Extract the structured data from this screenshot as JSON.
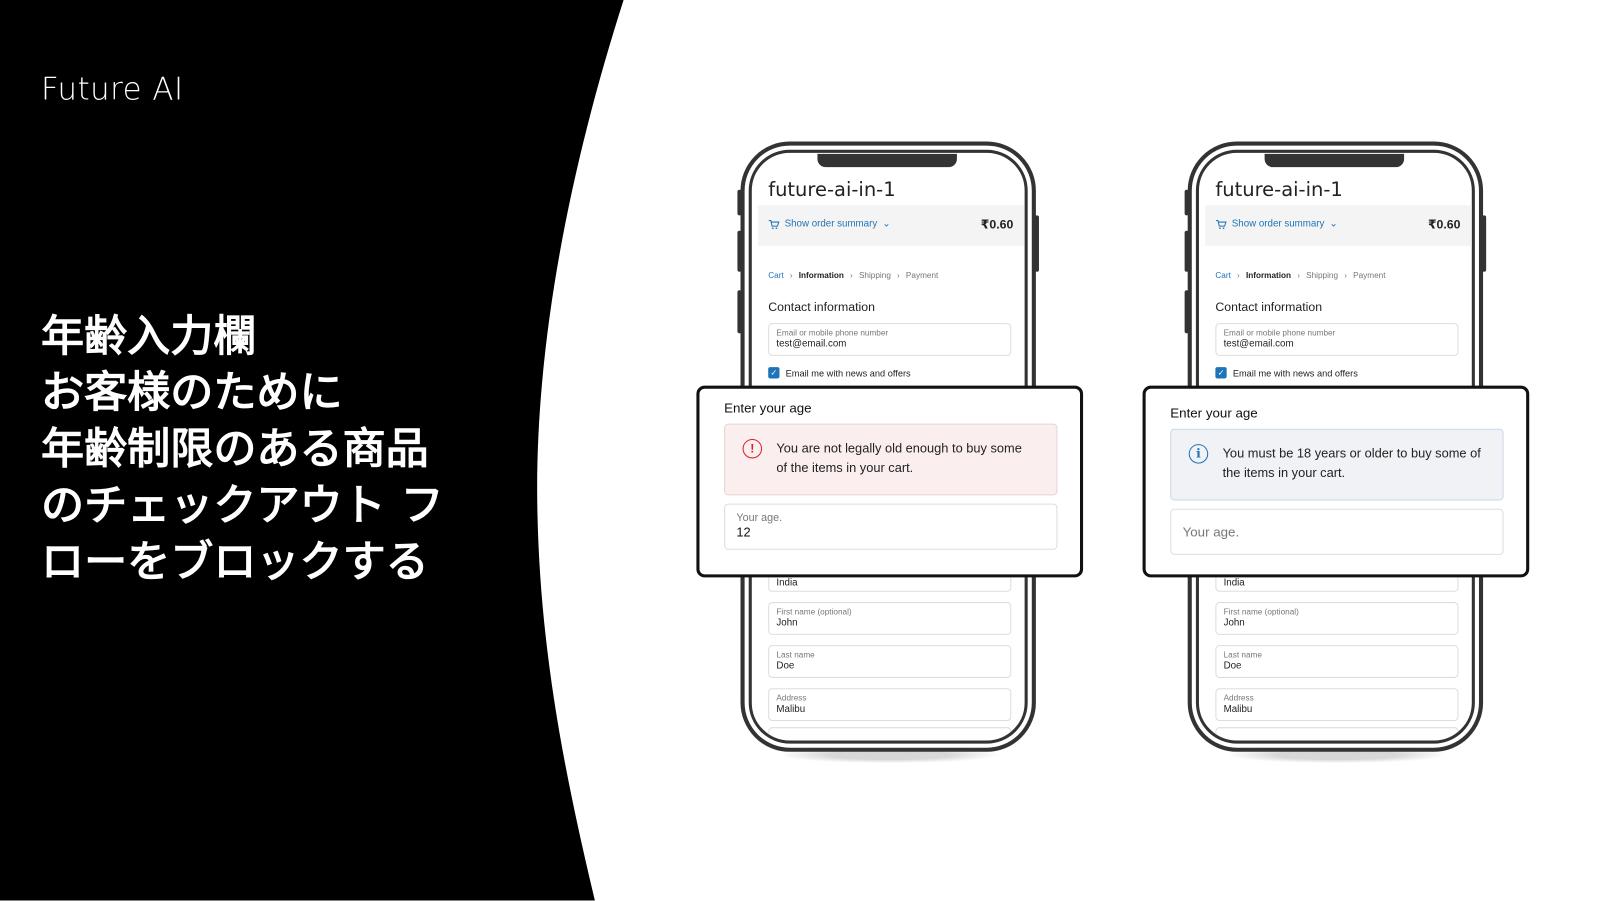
{
  "brand": "Future AI",
  "headline": [
    "年齢入力欄",
    "お客様のために",
    "年齢制限のある商品",
    "のチェックアウト フ",
    "ローをブロックする"
  ],
  "colors": {
    "link": "#1f73b7",
    "error": "#d91f26",
    "error_bg": "#fbeeee",
    "info_bg": "#f0f2f6",
    "panel": "#000000"
  },
  "phones": [
    {
      "store_title": "future-ai-in-1",
      "order_summary_label": "Show order summary",
      "cart_icon": "cart-icon",
      "price": "₹0.60",
      "breadcrumb": [
        "Cart",
        "Information",
        "Shipping",
        "Payment"
      ],
      "contact_heading": "Contact information",
      "email_label": "Email or mobile phone number",
      "email_value": "test@email.com",
      "newsletter_label": "Email me with news and offers",
      "newsletter_checked": true,
      "country_value": "India",
      "fields": [
        {
          "label": "First name (optional)",
          "value": "John"
        },
        {
          "label": "Last name",
          "value": "Doe"
        },
        {
          "label": "Address",
          "value": "Malibu"
        }
      ],
      "modal": {
        "title": "Enter your age",
        "alert_type": "error",
        "alert_icon": "exclamation-circle-icon",
        "alert_text": "You are not legally old enough to buy some of the items in your cart.",
        "age_label": "Your age.",
        "age_value": "12"
      }
    },
    {
      "store_title": "future-ai-in-1",
      "order_summary_label": "Show order summary",
      "cart_icon": "cart-icon",
      "price": "₹0.60",
      "breadcrumb": [
        "Cart",
        "Information",
        "Shipping",
        "Payment"
      ],
      "contact_heading": "Contact information",
      "email_label": "Email or mobile phone number",
      "email_value": "test@email.com",
      "newsletter_label": "Email me with news and offers",
      "newsletter_checked": true,
      "country_value": "India",
      "fields": [
        {
          "label": "First name (optional)",
          "value": "John"
        },
        {
          "label": "Last name",
          "value": "Doe"
        },
        {
          "label": "Address",
          "value": "Malibu"
        }
      ],
      "modal": {
        "title": "Enter your age",
        "alert_type": "info",
        "alert_icon": "info-circle-icon",
        "alert_text": "You must be 18 years or older to buy some of the items in your cart.",
        "age_placeholder": "Your age."
      }
    }
  ]
}
